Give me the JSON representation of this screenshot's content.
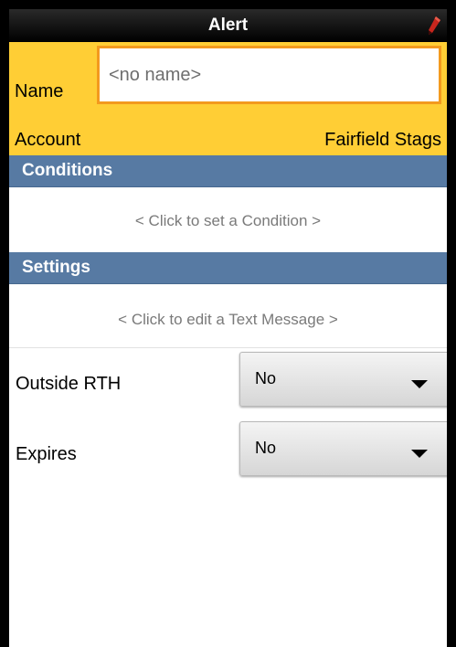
{
  "titlebar": {
    "title": "Alert",
    "edit_icon": "pen-icon"
  },
  "header": {
    "name_label": "Name",
    "name_placeholder": "<no name>",
    "name_value": "",
    "account_label": "Account",
    "account_value": "Fairfield Stags"
  },
  "conditions": {
    "title": "Conditions",
    "prompt": "< Click to set a Condition >"
  },
  "settings": {
    "title": "Settings",
    "prompt": "< Click to edit a Text Message >",
    "rows": [
      {
        "label": "Outside RTH",
        "value": "No"
      },
      {
        "label": "Expires",
        "value": "No"
      }
    ]
  },
  "colors": {
    "header_yellow": "#ffce35",
    "section_blue": "#577aa3",
    "input_border_orange": "#f39a1e"
  }
}
